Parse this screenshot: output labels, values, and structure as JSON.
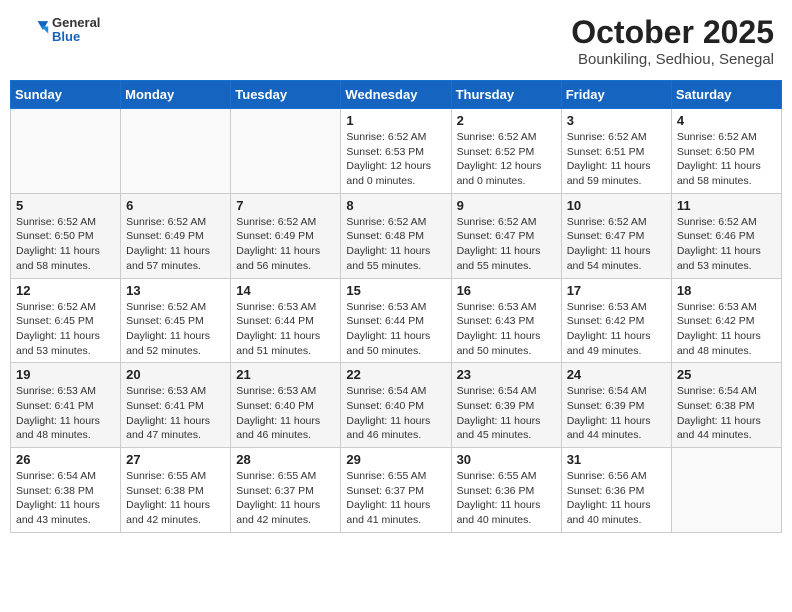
{
  "header": {
    "logo": {
      "general": "General",
      "blue": "Blue"
    },
    "title": "October 2025",
    "location": "Bounkiling, Sedhiou, Senegal"
  },
  "weekdays": [
    "Sunday",
    "Monday",
    "Tuesday",
    "Wednesday",
    "Thursday",
    "Friday",
    "Saturday"
  ],
  "weeks": [
    [
      {
        "day": "",
        "info": ""
      },
      {
        "day": "",
        "info": ""
      },
      {
        "day": "",
        "info": ""
      },
      {
        "day": "1",
        "info": "Sunrise: 6:52 AM\nSunset: 6:53 PM\nDaylight: 12 hours\nand 0 minutes."
      },
      {
        "day": "2",
        "info": "Sunrise: 6:52 AM\nSunset: 6:52 PM\nDaylight: 12 hours\nand 0 minutes."
      },
      {
        "day": "3",
        "info": "Sunrise: 6:52 AM\nSunset: 6:51 PM\nDaylight: 11 hours\nand 59 minutes."
      },
      {
        "day": "4",
        "info": "Sunrise: 6:52 AM\nSunset: 6:50 PM\nDaylight: 11 hours\nand 58 minutes."
      }
    ],
    [
      {
        "day": "5",
        "info": "Sunrise: 6:52 AM\nSunset: 6:50 PM\nDaylight: 11 hours\nand 58 minutes."
      },
      {
        "day": "6",
        "info": "Sunrise: 6:52 AM\nSunset: 6:49 PM\nDaylight: 11 hours\nand 57 minutes."
      },
      {
        "day": "7",
        "info": "Sunrise: 6:52 AM\nSunset: 6:49 PM\nDaylight: 11 hours\nand 56 minutes."
      },
      {
        "day": "8",
        "info": "Sunrise: 6:52 AM\nSunset: 6:48 PM\nDaylight: 11 hours\nand 55 minutes."
      },
      {
        "day": "9",
        "info": "Sunrise: 6:52 AM\nSunset: 6:47 PM\nDaylight: 11 hours\nand 55 minutes."
      },
      {
        "day": "10",
        "info": "Sunrise: 6:52 AM\nSunset: 6:47 PM\nDaylight: 11 hours\nand 54 minutes."
      },
      {
        "day": "11",
        "info": "Sunrise: 6:52 AM\nSunset: 6:46 PM\nDaylight: 11 hours\nand 53 minutes."
      }
    ],
    [
      {
        "day": "12",
        "info": "Sunrise: 6:52 AM\nSunset: 6:45 PM\nDaylight: 11 hours\nand 53 minutes."
      },
      {
        "day": "13",
        "info": "Sunrise: 6:52 AM\nSunset: 6:45 PM\nDaylight: 11 hours\nand 52 minutes."
      },
      {
        "day": "14",
        "info": "Sunrise: 6:53 AM\nSunset: 6:44 PM\nDaylight: 11 hours\nand 51 minutes."
      },
      {
        "day": "15",
        "info": "Sunrise: 6:53 AM\nSunset: 6:44 PM\nDaylight: 11 hours\nand 50 minutes."
      },
      {
        "day": "16",
        "info": "Sunrise: 6:53 AM\nSunset: 6:43 PM\nDaylight: 11 hours\nand 50 minutes."
      },
      {
        "day": "17",
        "info": "Sunrise: 6:53 AM\nSunset: 6:42 PM\nDaylight: 11 hours\nand 49 minutes."
      },
      {
        "day": "18",
        "info": "Sunrise: 6:53 AM\nSunset: 6:42 PM\nDaylight: 11 hours\nand 48 minutes."
      }
    ],
    [
      {
        "day": "19",
        "info": "Sunrise: 6:53 AM\nSunset: 6:41 PM\nDaylight: 11 hours\nand 48 minutes."
      },
      {
        "day": "20",
        "info": "Sunrise: 6:53 AM\nSunset: 6:41 PM\nDaylight: 11 hours\nand 47 minutes."
      },
      {
        "day": "21",
        "info": "Sunrise: 6:53 AM\nSunset: 6:40 PM\nDaylight: 11 hours\nand 46 minutes."
      },
      {
        "day": "22",
        "info": "Sunrise: 6:54 AM\nSunset: 6:40 PM\nDaylight: 11 hours\nand 46 minutes."
      },
      {
        "day": "23",
        "info": "Sunrise: 6:54 AM\nSunset: 6:39 PM\nDaylight: 11 hours\nand 45 minutes."
      },
      {
        "day": "24",
        "info": "Sunrise: 6:54 AM\nSunset: 6:39 PM\nDaylight: 11 hours\nand 44 minutes."
      },
      {
        "day": "25",
        "info": "Sunrise: 6:54 AM\nSunset: 6:38 PM\nDaylight: 11 hours\nand 44 minutes."
      }
    ],
    [
      {
        "day": "26",
        "info": "Sunrise: 6:54 AM\nSunset: 6:38 PM\nDaylight: 11 hours\nand 43 minutes."
      },
      {
        "day": "27",
        "info": "Sunrise: 6:55 AM\nSunset: 6:38 PM\nDaylight: 11 hours\nand 42 minutes."
      },
      {
        "day": "28",
        "info": "Sunrise: 6:55 AM\nSunset: 6:37 PM\nDaylight: 11 hours\nand 42 minutes."
      },
      {
        "day": "29",
        "info": "Sunrise: 6:55 AM\nSunset: 6:37 PM\nDaylight: 11 hours\nand 41 minutes."
      },
      {
        "day": "30",
        "info": "Sunrise: 6:55 AM\nSunset: 6:36 PM\nDaylight: 11 hours\nand 40 minutes."
      },
      {
        "day": "31",
        "info": "Sunrise: 6:56 AM\nSunset: 6:36 PM\nDaylight: 11 hours\nand 40 minutes."
      },
      {
        "day": "",
        "info": ""
      }
    ]
  ]
}
